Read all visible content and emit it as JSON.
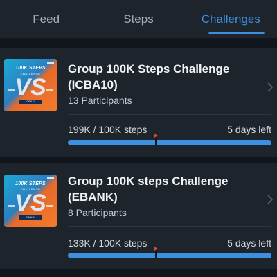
{
  "tabs": [
    {
      "label": "Feed",
      "active": false
    },
    {
      "label": "Steps",
      "active": false
    },
    {
      "label": "Challenges",
      "active": true
    }
  ],
  "colors": {
    "accent": "#3d8fe0",
    "background": "#11151c",
    "card": "#1e242c",
    "marker": "#e0453b"
  },
  "challenges": [
    {
      "thumbnail": {
        "title": "100K STEPS",
        "subtitle": "CHALLENGE",
        "vs": "VS",
        "tag": "ICBA10"
      },
      "title": "Group 100K Steps Challenge (ICBA10)",
      "participants": "13 Participants",
      "steps": "199K / 100K steps",
      "days_left": "5 days left",
      "progress_fraction": 1.0,
      "time_elapsed_fraction": 0.43,
      "chevron_icon": "chevron-right-icon"
    },
    {
      "thumbnail": {
        "title": "100K STEPS",
        "subtitle": "CHALLENGE",
        "vs": "VS",
        "tag": "EBANK"
      },
      "title": "Group 100K steps Challenge (EBANK)",
      "participants": "8 Participants",
      "steps": "133K / 100K steps",
      "days_left": "5 days left",
      "progress_fraction": 1.0,
      "time_elapsed_fraction": 0.43,
      "chevron_icon": "chevron-right-icon"
    }
  ]
}
